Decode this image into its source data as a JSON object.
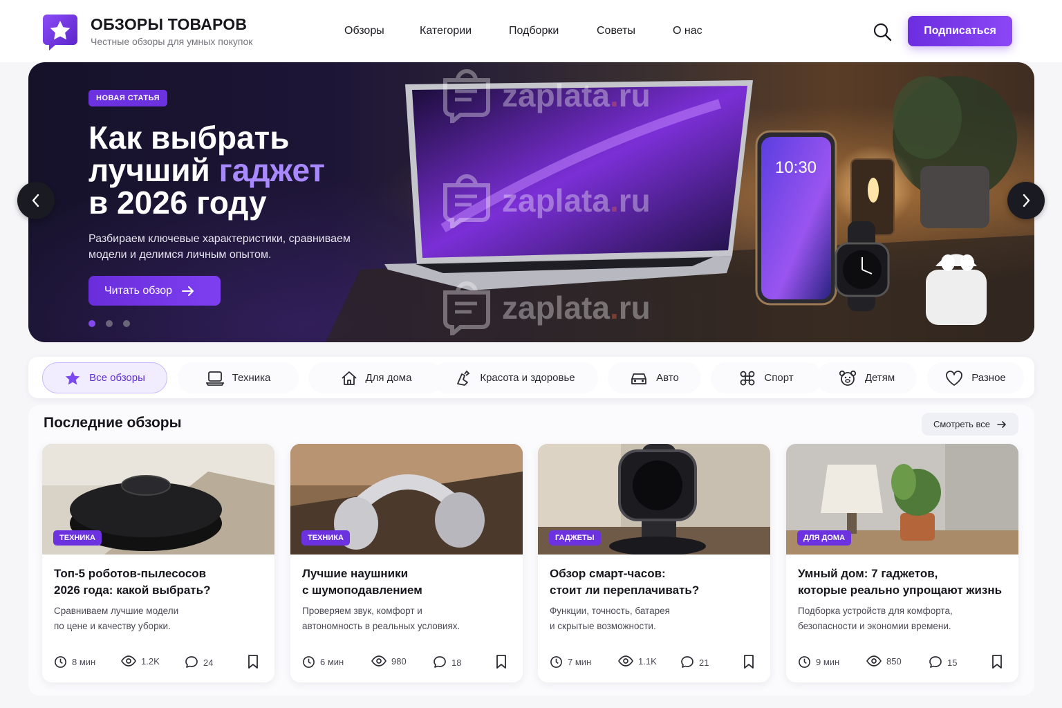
{
  "header": {
    "brand_title": "ОБЗОРЫ ТОВАРОВ",
    "brand_subtitle": "Честные обзоры для умных покупок",
    "nav": [
      "Обзоры",
      "Категории",
      "Подборки",
      "Советы",
      "О нас"
    ],
    "subscribe_label": "Подписаться"
  },
  "hero": {
    "badge": "НОВАЯ СТАТЬЯ",
    "title_line1": "Как выбрать",
    "title_line2_a": "лучший ",
    "title_line2_accent": "гаджет",
    "title_line3": "в 2026 году",
    "description": "Разбираем ключевые характеристики, сравниваем модели и делимся личным опытом.",
    "cta_label": "Читать обзор",
    "phone_time": "10:30",
    "slides_total": 3,
    "slide_active": 1,
    "watermark": "zaplata",
    "watermark_dot": ".",
    "watermark_tld": "ru"
  },
  "categories": [
    {
      "label": "Все обзоры",
      "icon": "star-icon",
      "active": true
    },
    {
      "label": "Техника",
      "icon": "laptop-icon"
    },
    {
      "label": "Для дома",
      "icon": "home-icon"
    },
    {
      "label": "Красота и здоровье",
      "icon": "beauty-icon"
    },
    {
      "label": "Авто",
      "icon": "car-icon"
    },
    {
      "label": "Спорт",
      "icon": "sport-icon"
    },
    {
      "label": "Детям",
      "icon": "bear-icon"
    },
    {
      "label": "Разное",
      "icon": "heart-icon"
    }
  ],
  "latest": {
    "title": "Последние обзоры",
    "see_all": "Смотреть все",
    "cards": [
      {
        "tag": "ТЕХНИКА",
        "title_1": "Топ-5 роботов-пылесосов",
        "title_2": "2026 года: какой выбрать?",
        "desc_1": "Сравниваем лучшие модели",
        "desc_2": "по цене и качеству уборки.",
        "time": "8 мин",
        "views": "1.2K",
        "comments": "24"
      },
      {
        "tag": "ТЕХНИКА",
        "title_1": "Лучшие наушники",
        "title_2": "с шумоподавлением",
        "desc_1": "Проверяем звук, комфорт и",
        "desc_2": "автономность в реальных условиях.",
        "time": "6 мин",
        "views": "980",
        "comments": "18"
      },
      {
        "tag": "ГАДЖЕТЫ",
        "title_1": "Обзор смарт-часов:",
        "title_2": "стоит ли переплачивать?",
        "desc_1": "Функции, точность, батарея",
        "desc_2": "и скрытые возможности.",
        "time": "7 мин",
        "views": "1.1K",
        "comments": "21"
      },
      {
        "tag": "ДЛЯ ДОМА",
        "title_1": "Умный дом: 7 гаджетов,",
        "title_2": "которые реально упрощают жизнь",
        "desc_1": "Подборка устройств для комфорта,",
        "desc_2": "безопасности и экономии времени.",
        "time": "9 мин",
        "views": "850",
        "comments": "15"
      }
    ]
  },
  "colors": {
    "accent": "#6d32df",
    "accent_light": "#a889ff",
    "dark": "#16161c"
  }
}
